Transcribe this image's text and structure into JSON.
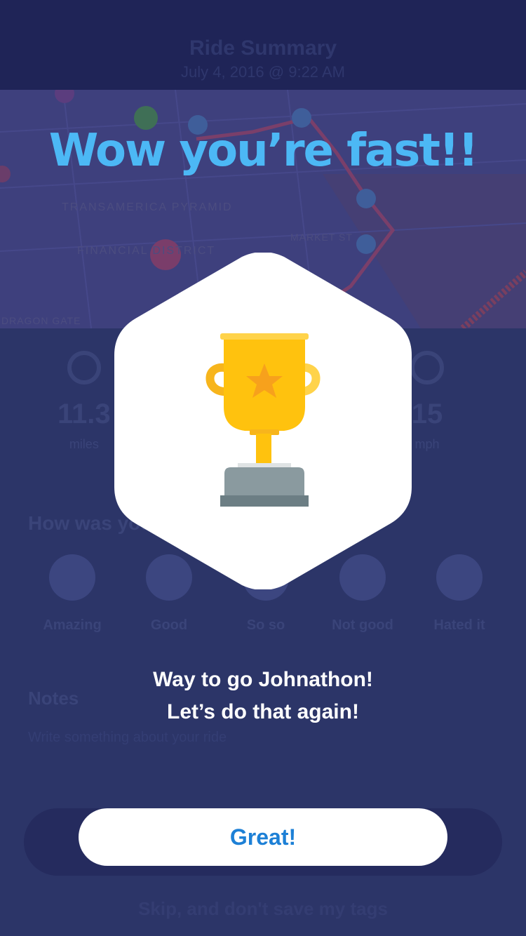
{
  "background": {
    "header": {
      "title": "Ride Summary",
      "subtitle": "July 4, 2016 @ 9:22 AM"
    },
    "map": {
      "labels": [
        "TRANSAMERICA PYRAMID",
        "FINANCIAL DISTRICT",
        "DRAGON GATE",
        "MARKET ST"
      ]
    },
    "stats": [
      {
        "value": "11.3",
        "label": "miles"
      },
      {
        "value": "15",
        "label": "mph"
      }
    ],
    "question": "How was your ride?",
    "moods": [
      "Amazing",
      "Good",
      "So so",
      "Not good",
      "Hated it"
    ],
    "notes_title": "Notes",
    "notes_placeholder": "Write something about your ride",
    "skip_label": "Skip, and don't save my tags"
  },
  "modal": {
    "headline": "Wow you’re fast!!",
    "icon": "trophy-icon",
    "message_line1": "Way to go Johnathon!",
    "message_line2": "Let’s do that again!",
    "button_label": "Great!"
  },
  "colors": {
    "headline": "#4cb8f5",
    "button_text": "#1d80d6",
    "trophy_gold": "#ffc20e",
    "trophy_base": "#8a9a9f",
    "overlay_bg": "#2b3468"
  }
}
